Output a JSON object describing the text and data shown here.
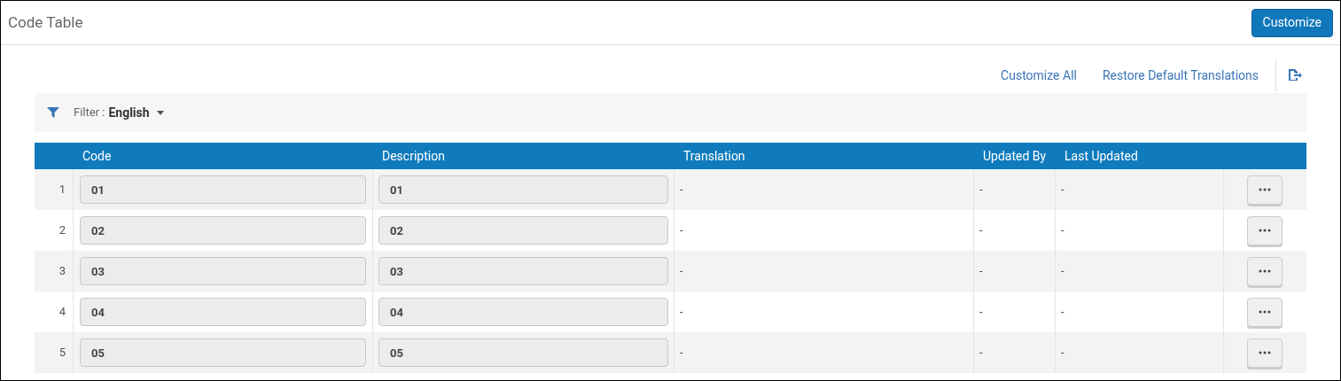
{
  "header": {
    "title": "Code Table",
    "customize_button": "Customize"
  },
  "actions": {
    "links": [
      "Customize All",
      "Restore Default Translations"
    ]
  },
  "filter": {
    "label": "Filter :",
    "value": "English"
  },
  "table": {
    "columns": [
      "Code",
      "Description",
      "Translation",
      "Updated By",
      "Last Updated"
    ],
    "rows": [
      {
        "index": "1",
        "code": "01",
        "description": "01",
        "translation": "-",
        "updated_by": "-",
        "last_updated": "-"
      },
      {
        "index": "2",
        "code": "02",
        "description": "02",
        "translation": "-",
        "updated_by": "-",
        "last_updated": "-"
      },
      {
        "index": "3",
        "code": "03",
        "description": "03",
        "translation": "-",
        "updated_by": "-",
        "last_updated": "-"
      },
      {
        "index": "4",
        "code": "04",
        "description": "04",
        "translation": "-",
        "updated_by": "-",
        "last_updated": "-"
      },
      {
        "index": "5",
        "code": "05",
        "description": "05",
        "translation": "-",
        "updated_by": "-",
        "last_updated": "-"
      }
    ]
  }
}
